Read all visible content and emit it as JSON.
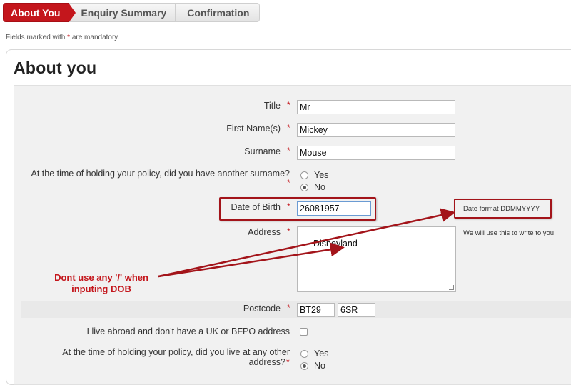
{
  "steps": [
    {
      "label": "About You",
      "active": true
    },
    {
      "label": "Enquiry Summary",
      "active": false
    },
    {
      "label": "Confirmation",
      "active": false
    }
  ],
  "mandatory_note": {
    "prefix": "Fields marked with ",
    "star": "*",
    "suffix": " are mandatory."
  },
  "section_title": "About you",
  "required_mark": "*",
  "fields": {
    "title": {
      "label": "Title",
      "value": "Mr"
    },
    "first_name": {
      "label": "First Name(s)",
      "value": "Mickey"
    },
    "surname": {
      "label": "Surname",
      "value": "Mouse"
    },
    "other_surname": {
      "label": "At the time of holding your policy, did you have another surname?",
      "options": [
        "Yes",
        "No"
      ],
      "selected": "No"
    },
    "dob": {
      "label": "Date of Birth",
      "value": "26081957",
      "hint": "Date format DDMMYYYY"
    },
    "address": {
      "label": "Address",
      "value": "Disneyland",
      "hint": "We will use this to write to you."
    },
    "postcode": {
      "label": "Postcode",
      "part1": "BT29",
      "part2": "6SR"
    },
    "abroad": {
      "label": "I live abroad and don't have a UK or BFPO address",
      "checked": false
    },
    "other_address": {
      "label_line1": "At the time of holding your policy, did you live at any other",
      "label_line2": "address?",
      "options": [
        "Yes",
        "No"
      ],
      "selected": "No"
    }
  },
  "annotation": {
    "line1": "Dont use any '/' when",
    "line2": "inputing DOB"
  },
  "colors": {
    "accent": "#c4161c",
    "annotation_box": "#a3141a"
  }
}
